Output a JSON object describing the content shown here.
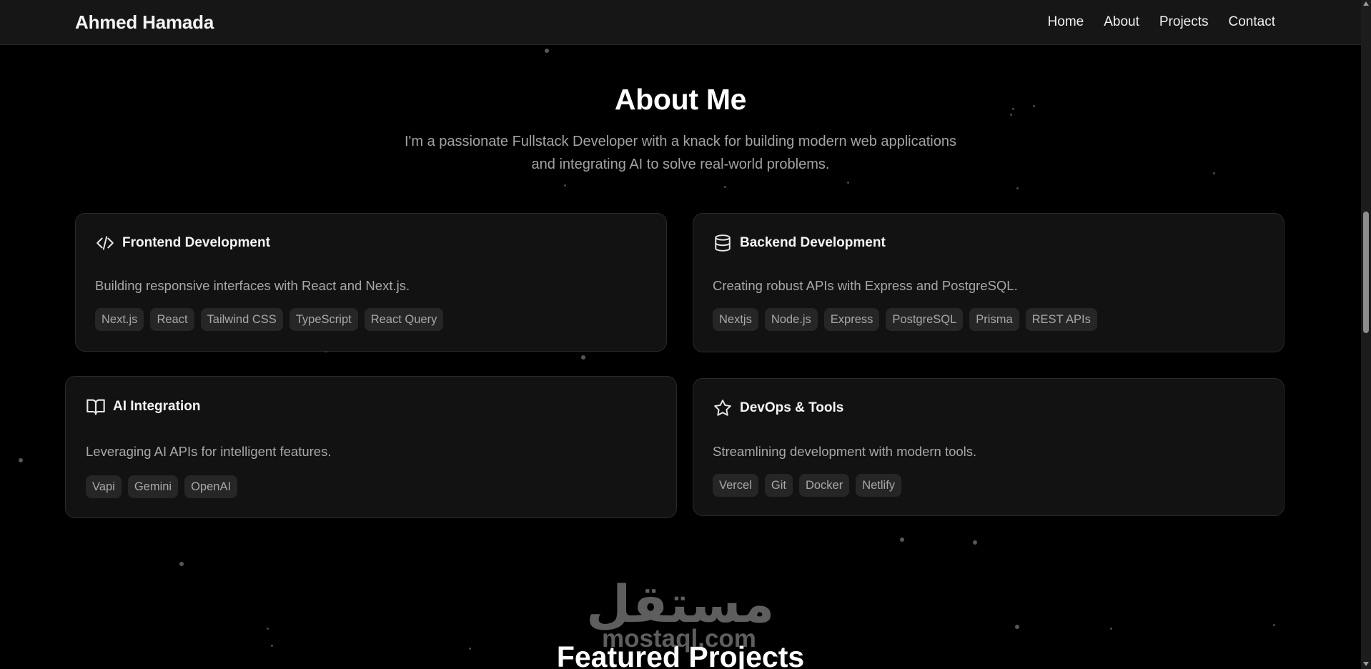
{
  "nav": {
    "brand": "Ahmed Hamada",
    "links": [
      "Home",
      "About",
      "Projects",
      "Contact"
    ]
  },
  "about": {
    "title": "About Me",
    "description_line1": "I'm a passionate Fullstack Developer with a knack for building modern web applications",
    "description_line2": "and integrating AI to solve real-world problems."
  },
  "cards": [
    {
      "icon": "code-icon",
      "title": "Frontend Development",
      "description": "Building responsive interfaces with React and Next.js.",
      "tags": [
        "Next.js",
        "React",
        "Tailwind CSS",
        "TypeScript",
        "React Query"
      ]
    },
    {
      "icon": "database-icon",
      "title": "Backend Development",
      "description": "Creating robust APIs with Express and PostgreSQL.",
      "tags": [
        "Nextjs",
        "Node.js",
        "Express",
        "PostgreSQL",
        "Prisma",
        "REST APIs"
      ]
    },
    {
      "icon": "book-open-icon",
      "title": "AI Integration",
      "description": "Leveraging AI APIs for intelligent features.",
      "tags": [
        "Vapi",
        "Gemini",
        "OpenAI"
      ]
    },
    {
      "icon": "star-icon",
      "title": "DevOps & Tools",
      "description": "Streamlining development with modern tools.",
      "tags": [
        "Vercel",
        "Git",
        "Docker",
        "Netlify"
      ]
    }
  ],
  "watermark": {
    "arabic": "مستقل",
    "latin": "mostaql.com"
  },
  "featured": {
    "title": "Featured Projects"
  },
  "colors": {
    "background": "#000000",
    "navbar": "#161616",
    "card": "#121212",
    "tag": "#262626",
    "muted_text": "#a3a3a3"
  }
}
